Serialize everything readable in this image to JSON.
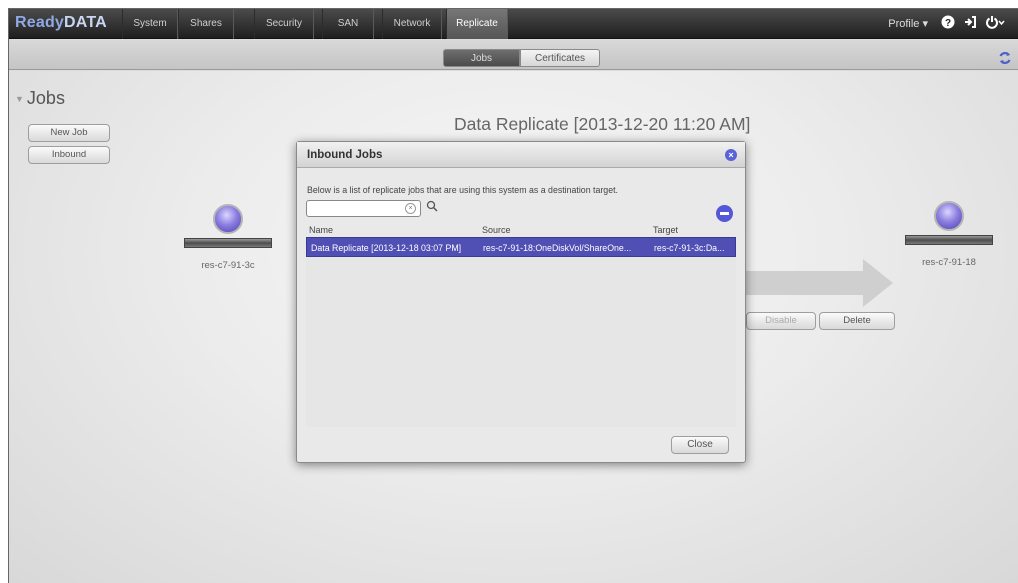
{
  "app": {
    "logo_ready": "Ready",
    "logo_data": "DATA"
  },
  "nav": {
    "tabs": [
      "System",
      "Shares",
      "Security",
      "SAN",
      "Network",
      "Replicate"
    ],
    "active": "Replicate",
    "profile": "Profile ▾"
  },
  "subnav": {
    "jobs": "Jobs",
    "certificates": "Certificates"
  },
  "sidebar": {
    "title": "Jobs",
    "new_job": "New Job",
    "inbound": "Inbound"
  },
  "main": {
    "title": "Data Replicate [2013-12-20 11:20 AM]",
    "source_host": "res-c7-91-3c",
    "target_host": "res-c7-91-18",
    "disable_label": "Disable",
    "delete_label": "Delete"
  },
  "dialog": {
    "title": "Inbound Jobs",
    "description": "Below is a list of replicate jobs that are using this system as a destination target.",
    "search_value": "",
    "columns": [
      "Name",
      "Source",
      "Target"
    ],
    "rows": [
      [
        "Data Replicate [2013-12-18 03:07 PM]",
        "res-c7-91-18:OneDiskVol/ShareOne...",
        "res-c7-91-3c:Da..."
      ]
    ],
    "close_label": "Close"
  },
  "colors": {
    "accent": "#4f4fb4",
    "logo": "#8fa9e6",
    "topbar": "#2a2a2a"
  }
}
